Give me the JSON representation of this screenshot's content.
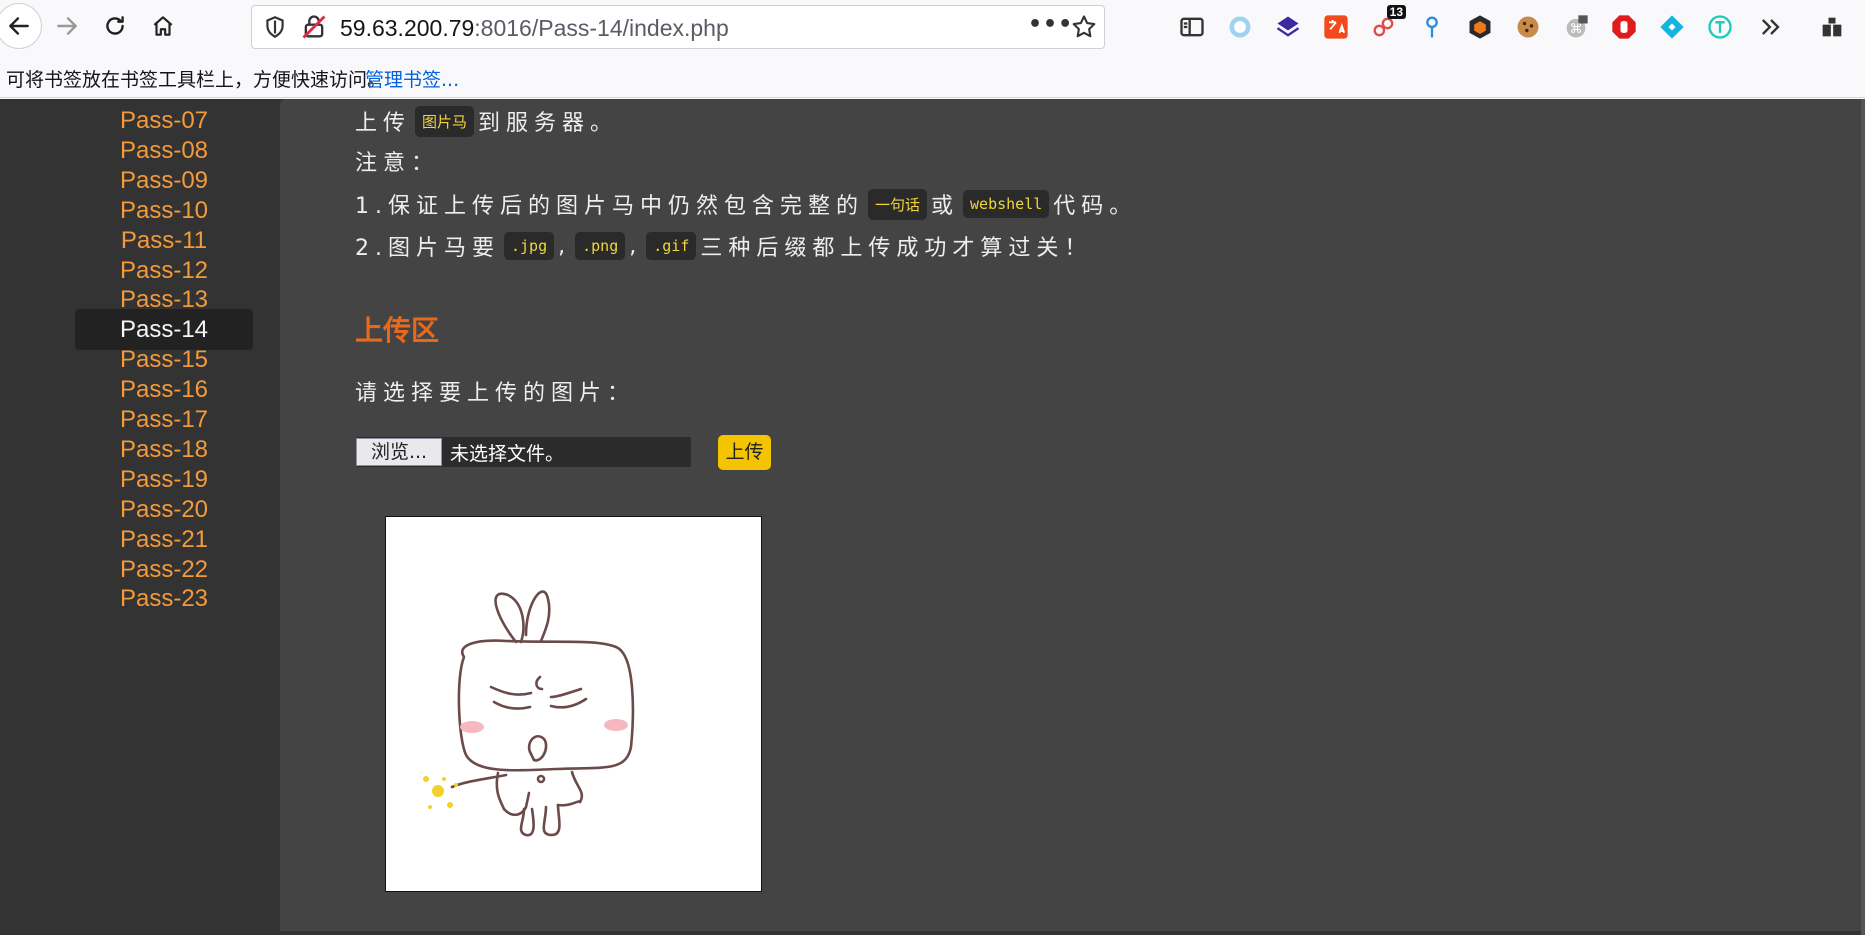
{
  "browser": {
    "url_host": "59.63.200.79",
    "url_rest": ":8016/Pass-14/index.php",
    "extension_badge": "13",
    "bookmarks_hint": "可将书签放在书签工具栏上，方便快速访问。",
    "bookmarks_link": "管理书签..."
  },
  "sidebar": {
    "items": [
      "Pass-07",
      "Pass-08",
      "Pass-09",
      "Pass-10",
      "Pass-11",
      "Pass-12",
      "Pass-13",
      "Pass-14",
      "Pass-15",
      "Pass-16",
      "Pass-17",
      "Pass-18",
      "Pass-19",
      "Pass-20",
      "Pass-21",
      "Pass-22",
      "Pass-23"
    ],
    "active": "Pass-14"
  },
  "task": {
    "line1_pre": "上传",
    "line1_code": "图片马",
    "line1_post": "到服务器。",
    "note": "注意：",
    "line2_pre": "1.保证上传后的图片马中仍然包含完整的",
    "line2_code1": "一句话",
    "line2_mid": "或",
    "line2_code2": "webshell",
    "line2_post": "代码。",
    "line3_pre": "2.图片马要",
    "line3_code1": ".jpg",
    "line3_sep1": ",",
    "line3_code2": ".png",
    "line3_sep2": ",",
    "line3_code3": ".gif",
    "line3_post": "三种后缀都上传成功才算过关！"
  },
  "upload": {
    "heading": "上传区",
    "prompt": "请选择要上传的图片：",
    "browse_label": "浏览...",
    "no_file_label": "未选择文件。",
    "submit_label": "上传"
  },
  "colors": {
    "accent_orange": "#e8691c",
    "link_orange": "#f39a3b",
    "code_yellow": "#f0d63a",
    "button_yellow": "#f5c400",
    "content_bg": "#444444",
    "sidebar_bg": "#333333"
  }
}
